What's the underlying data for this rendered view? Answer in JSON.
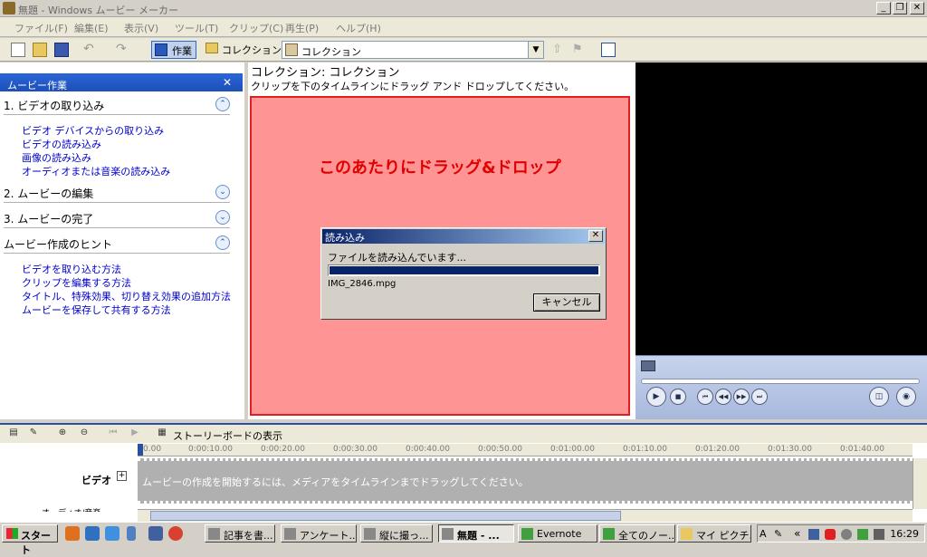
{
  "window": {
    "title": "無題 - Windows ムービー メーカー",
    "controls": [
      "_",
      "❐",
      "✕"
    ]
  },
  "menu": [
    "ファイル(F)",
    "編集(E)",
    "表示(V)",
    "ツール(T)",
    "クリップ(C)",
    "再生(P)",
    "ヘルプ(H)"
  ],
  "toolbar": {
    "tasks_label": "作業",
    "collections_label": "コレクション",
    "combo_value": "コレクション"
  },
  "sidebar": {
    "header": "ムービー作業",
    "close": "✕",
    "sections": [
      {
        "label": "1. ビデオの取り込み",
        "toggle": "⌃"
      },
      {
        "label": "2. ムービーの編集",
        "toggle": "⌄"
      },
      {
        "label": "3. ムービーの完了",
        "toggle": "⌄"
      },
      {
        "label": "ムービー作成のヒント",
        "toggle": "⌃"
      }
    ],
    "capture_links": [
      "ビデオ デバイスからの取り込み",
      "ビデオの読み込み",
      "画像の読み込み",
      "オーディオまたは音楽の読み込み"
    ],
    "tips_links": [
      "ビデオを取り込む方法",
      "クリップを編集する方法",
      "タイトル、特殊効果、切り替え効果の追加方法",
      "ムービーを保存して共有する方法"
    ]
  },
  "collection": {
    "title": "コレクション: コレクション",
    "subtitle": "クリップを下のタイムラインにドラッグ アンド ドロップしてください。",
    "drop_message": "このあたりにドラッグ&ドロップ"
  },
  "dialog": {
    "title": "読み込み",
    "close": "✕",
    "message": "ファイルを読み込んでいます...",
    "progress": 1.0,
    "filename": "IMG_2846.mpg",
    "cancel_label": "キャンセル"
  },
  "timeline": {
    "storyboard_label": "ストーリーボードの表示",
    "ticks": [
      "0.00",
      "0:00:10.00",
      "0:00:20.00",
      "0:00:30.00",
      "0:00:40.00",
      "0:00:50.00",
      "0:01:00.00",
      "0:01:10.00",
      "0:01:20.00",
      "0:01:30.00",
      "0:01:40.00"
    ],
    "video_label": "ビデオ",
    "expand": "+",
    "hint": "ムービーの作成を開始するには、メディアをタイムラインまでドラッグしてください。",
    "next_track_partial": "オーディオ/音楽"
  },
  "taskbar": {
    "start_label": "スタート",
    "tasks": [
      {
        "label": "記事を書...",
        "active": false
      },
      {
        "label": "アンケート...",
        "active": false
      },
      {
        "label": "縦に撮っ...",
        "active": false
      },
      {
        "label": "無題 - ...",
        "active": true
      },
      {
        "label": "Evernote",
        "active": false
      },
      {
        "label": "全てのノー...",
        "active": false
      },
      {
        "label": "マイ ピクチ...",
        "active": false
      }
    ],
    "ime": "A",
    "clock": "16:29"
  }
}
